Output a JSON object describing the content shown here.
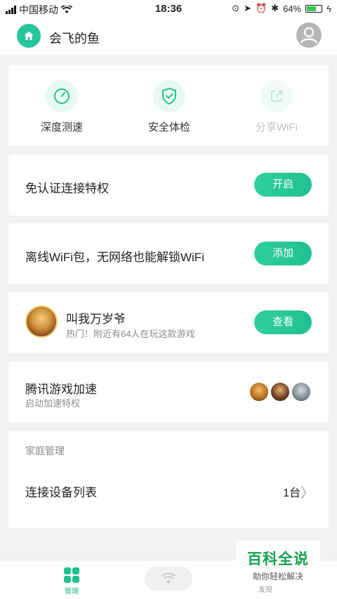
{
  "status": {
    "carrier": "中国移动",
    "time": "18:36",
    "battery": "64%",
    "battery_level": 0.64
  },
  "header": {
    "title": "会飞的鱼"
  },
  "tools": [
    {
      "label": "深度测速",
      "icon": "speedometer-icon"
    },
    {
      "label": "安全体检",
      "icon": "shield-check-icon"
    },
    {
      "label": "分享WiFi",
      "icon": "share-icon"
    }
  ],
  "cards": {
    "free_auth": {
      "title": "免认证连接特权",
      "button": "开启"
    },
    "offline_pack": {
      "title": "离线WiFi包，无网络也能解锁WiFi",
      "button": "添加"
    },
    "game": {
      "title": "叫我万岁爷",
      "subtitle": "热门！附近有64人在玩这款游戏",
      "button": "查看"
    },
    "tencent": {
      "title": "腾讯游戏加速",
      "subtitle": "启动加速特权"
    },
    "family": {
      "label": "家庭管理",
      "row_title": "连接设备列表",
      "count": "1台"
    }
  },
  "tabbar": {
    "manage": "管理",
    "discover": "发现"
  },
  "watermark": {
    "title": "百科全说",
    "subtitle": "助你轻松解决"
  },
  "colors": {
    "accent": "#22c090",
    "background": "#f2f2f2"
  }
}
